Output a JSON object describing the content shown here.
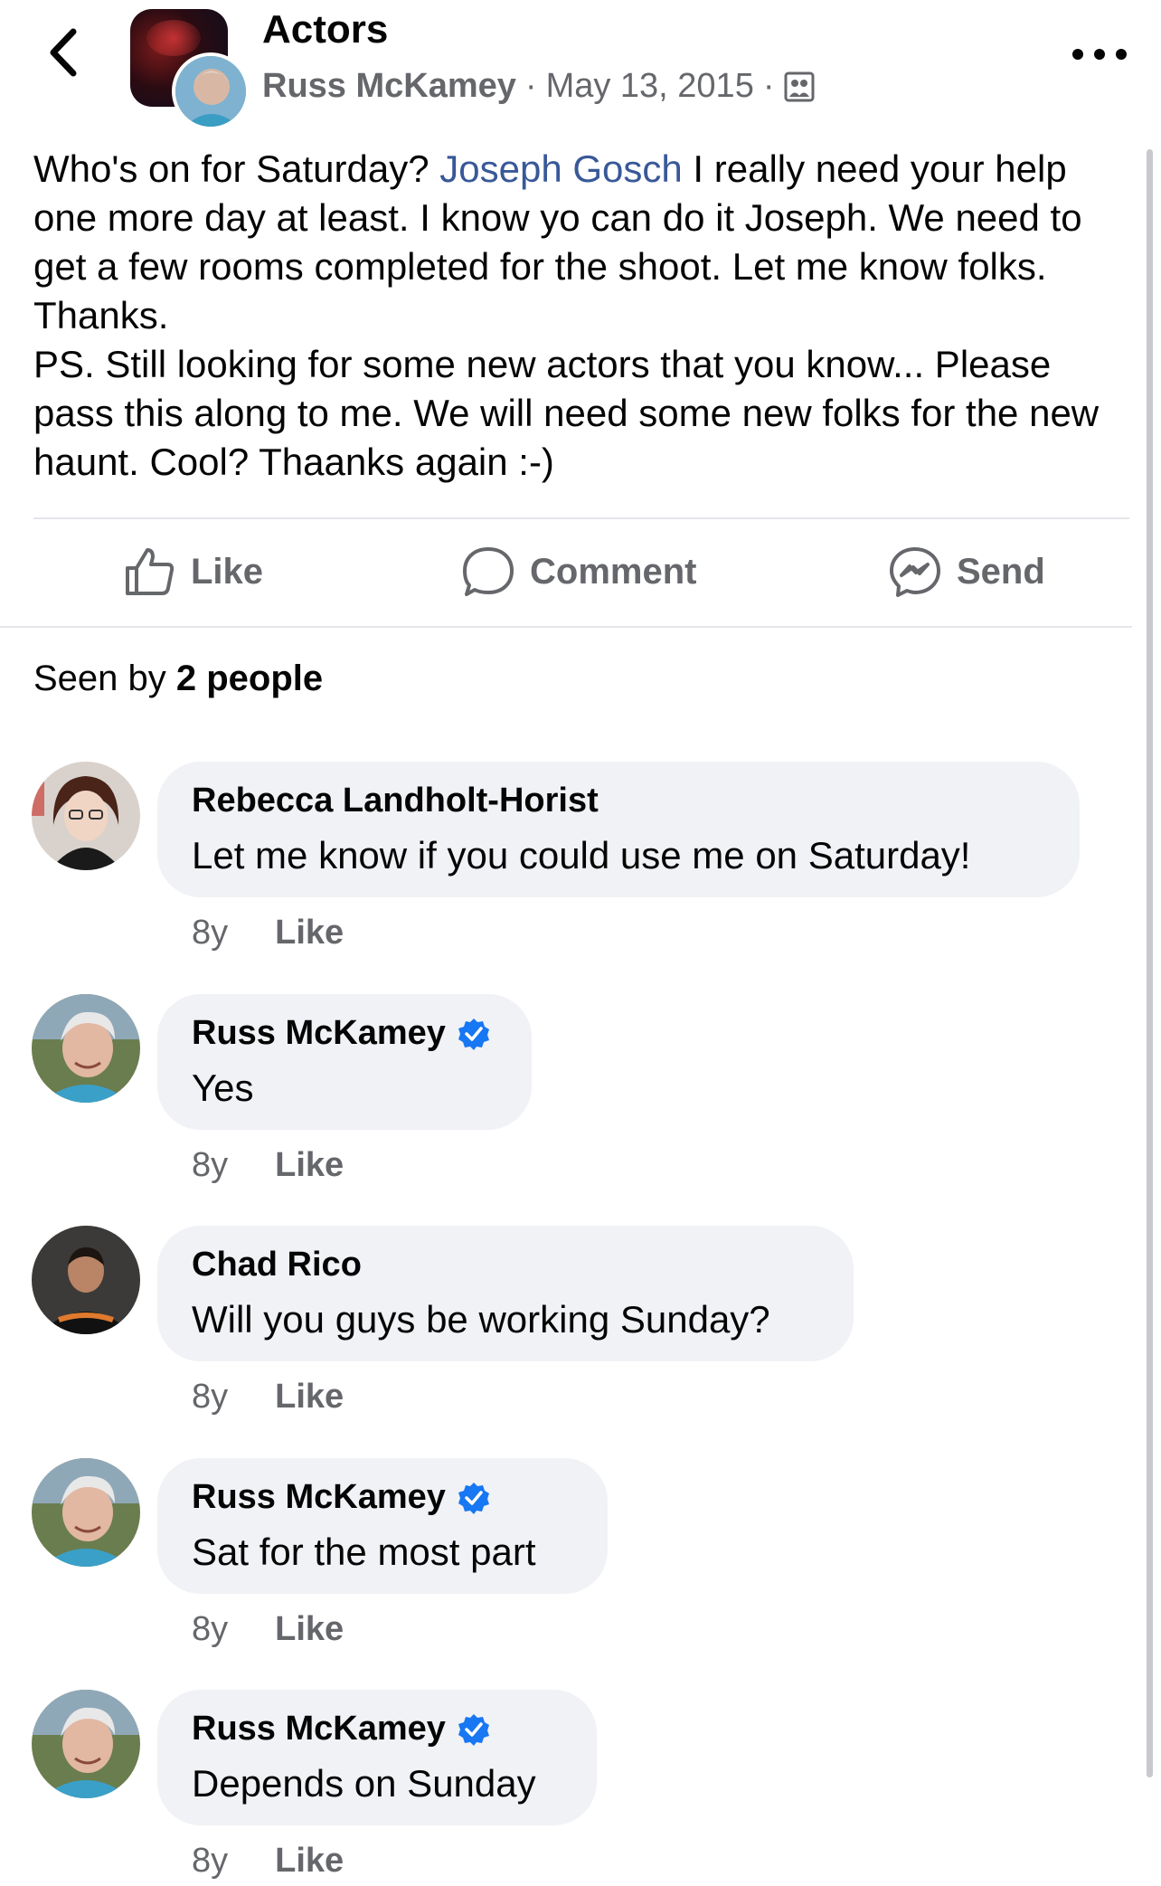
{
  "header": {
    "group_title": "Actors",
    "author": "Russ McKamey",
    "separator": "·",
    "date": "May 13, 2015"
  },
  "post": {
    "line1_before": "Who's on for Saturday? ",
    "mention": "Joseph Gosch",
    "line1_after": " I really need your help one more day at least.  I know yo can do it Joseph. We need to get a few rooms completed for the shoot.  Let me know folks.  Thanks.",
    "line2": "PS.   Still looking for some new actors that you know... Please pass this along to me.  We will need some new folks for the new haunt.  Cool?   Thaanks again :-)"
  },
  "actions": {
    "like": "Like",
    "comment": "Comment",
    "send": "Send"
  },
  "seen": {
    "prefix": "Seen by ",
    "count": "2 people"
  },
  "colors": {
    "mention": "#385898",
    "verified": "#1877f2",
    "bubble": "#f0f2f5",
    "meta": "#65676b"
  },
  "comments": [
    {
      "name": "Rebecca Landholt-Horist",
      "text": "Let me know if you could use me on Saturday!",
      "verified": false,
      "time": "8y",
      "like": "Like"
    },
    {
      "name": "Russ McKamey",
      "text": "Yes",
      "verified": true,
      "time": "8y",
      "like": "Like"
    },
    {
      "name": "Chad Rico",
      "text": "Will you guys be working Sunday?",
      "verified": false,
      "time": "8y",
      "like": "Like"
    },
    {
      "name": "Russ McKamey",
      "text": "Sat for the most part",
      "verified": true,
      "time": "8y",
      "like": "Like"
    },
    {
      "name": "Russ McKamey",
      "text": "Depends on Sunday",
      "verified": true,
      "time": "8y",
      "like": "Like"
    }
  ]
}
